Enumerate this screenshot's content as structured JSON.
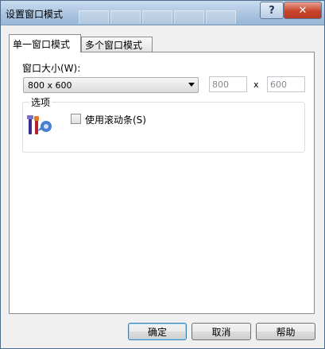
{
  "window": {
    "title": "设置窗口模式",
    "help_glyph": "?",
    "close_glyph": "✕"
  },
  "tabs": [
    {
      "label": "单一窗口模式",
      "active": true
    },
    {
      "label": "多个窗口模式",
      "active": false
    }
  ],
  "window_size": {
    "label": "窗口大小(W):",
    "selected": "800 x 600",
    "width_value": "800",
    "separator": "x",
    "height_value": "600"
  },
  "options": {
    "group_label": "选项",
    "icon": "tools-options-icon",
    "scrollbar_checkbox_label": "使用滚动条(S)",
    "scrollbar_checked": false
  },
  "buttons": {
    "ok": "确定",
    "cancel": "取消",
    "help": "帮助"
  },
  "colors": {
    "titlebar": "#a9c3de",
    "close_button": "#c8442a",
    "default_button_border": "#3c7fb1"
  }
}
